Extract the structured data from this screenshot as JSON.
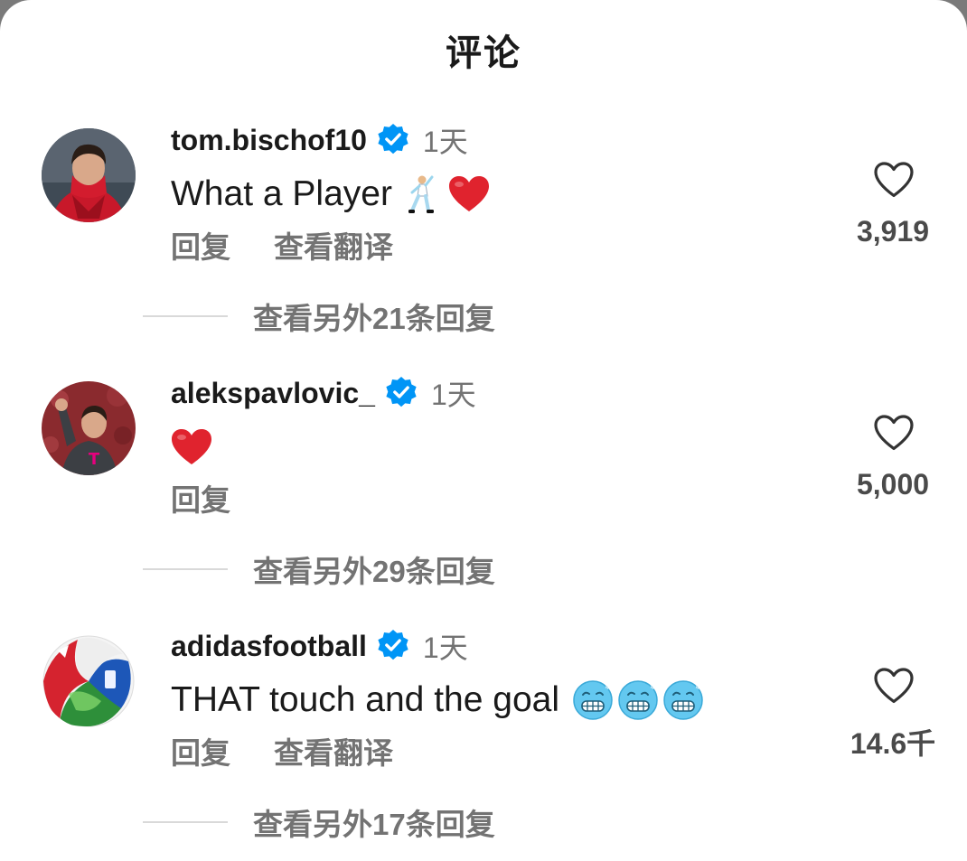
{
  "sheet": {
    "title": "评论"
  },
  "comments": [
    {
      "username": "tom.bischof10",
      "verified": true,
      "time": "1天",
      "text": "What a Player",
      "emojis": [
        "dancing-man-emoji",
        "red-heart-emoji"
      ],
      "reply_label": "回复",
      "translate_label": "查看翻译",
      "like_count": "3,919",
      "replies_label": "查看另外21条回复"
    },
    {
      "username": "alekspavlovic_",
      "verified": true,
      "time": "1天",
      "text": "",
      "emojis": [
        "red-heart-emoji"
      ],
      "reply_label": "回复",
      "like_count": "5,000",
      "replies_label": "查看另外29条回复"
    },
    {
      "username": "adidasfootball",
      "verified": true,
      "time": "1天",
      "text": "THAT touch and the goal",
      "emojis": [
        "cold-face-emoji",
        "cold-face-emoji",
        "cold-face-emoji"
      ],
      "reply_label": "回复",
      "translate_label": "查看翻译",
      "like_count": "14.6千",
      "replies_label": "查看另外17条回复"
    }
  ],
  "colors": {
    "verified_badge": "#0095f6",
    "heart_emoji": "#e0232e",
    "cold_face": "#63c8f0",
    "secondary_text": "#737373"
  }
}
